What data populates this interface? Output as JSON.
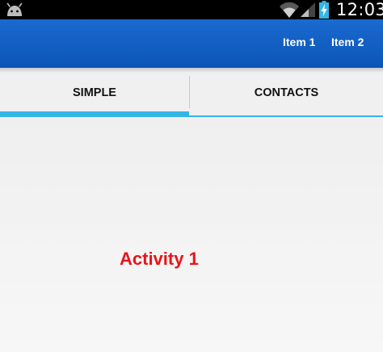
{
  "status_bar": {
    "time": "12:03",
    "icons": [
      "android-icon",
      "wifi-icon",
      "signal-icon",
      "battery-charging-icon"
    ]
  },
  "action_bar": {
    "items": [
      {
        "label": "Item 1"
      },
      {
        "label": "Item 2"
      }
    ],
    "color": "#0c55b8"
  },
  "tabs": [
    {
      "label": "SIMPLE",
      "selected": true
    },
    {
      "label": "CONTACTS",
      "selected": false
    }
  ],
  "tab_indicator_color": "#33b5e5",
  "content": {
    "label": "Activity 1",
    "label_color": "#e8141b"
  }
}
